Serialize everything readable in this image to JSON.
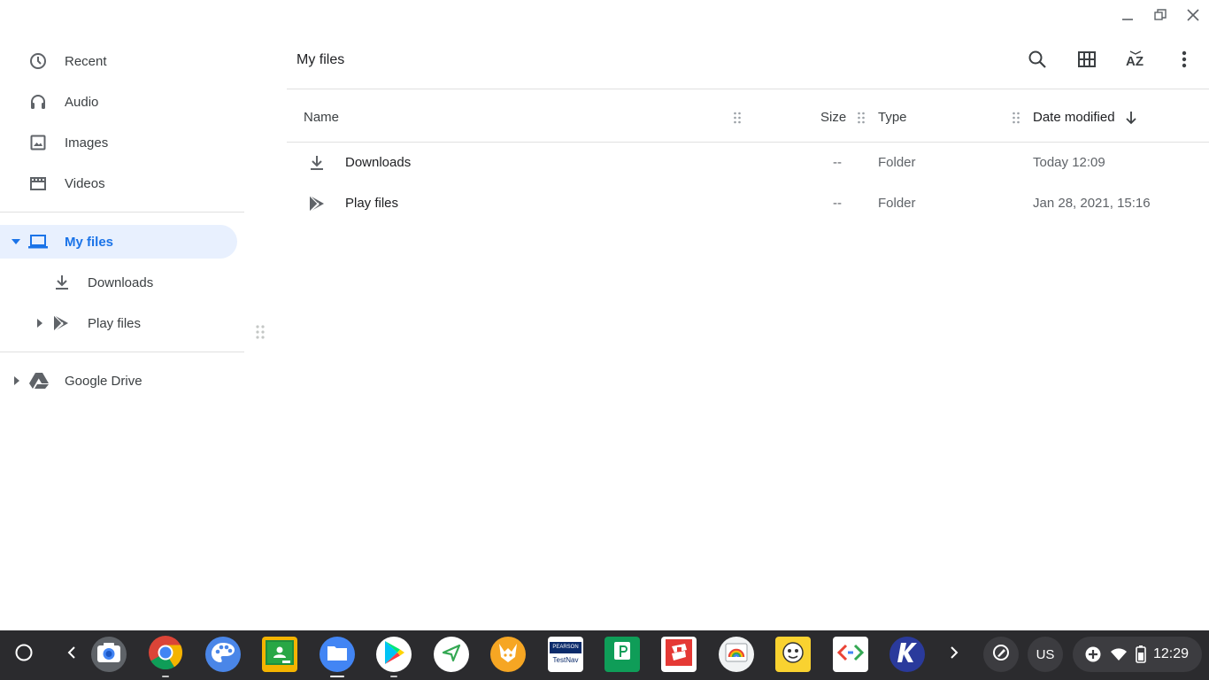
{
  "window": {
    "controls": [
      "minimize-icon",
      "restore-icon",
      "close-icon"
    ]
  },
  "sidebar": {
    "items": [
      {
        "label": "Recent",
        "icon": "clock-icon"
      },
      {
        "label": "Audio",
        "icon": "headphones-icon"
      },
      {
        "label": "Images",
        "icon": "image-icon"
      },
      {
        "label": "Videos",
        "icon": "video-icon"
      }
    ],
    "my_files": {
      "label": "My files",
      "icon": "laptop-icon",
      "expanded": true
    },
    "children": [
      {
        "label": "Downloads",
        "icon": "download-icon"
      },
      {
        "label": "Play files",
        "icon": "play-store-icon"
      }
    ],
    "drive": {
      "label": "Google Drive",
      "icon": "google-drive-icon"
    }
  },
  "main": {
    "title": "My files",
    "toolbar": [
      "search-icon",
      "grid-view-icon",
      "sort-az-icon",
      "more-vert-icon"
    ],
    "columns": {
      "name": "Name",
      "size": "Size",
      "type": "Type",
      "date": "Date modified"
    },
    "rows": [
      {
        "name": "Downloads",
        "size": "--",
        "type": "Folder",
        "date": "Today 12:09",
        "icon": "download-icon"
      },
      {
        "name": "Play files",
        "size": "--",
        "type": "Folder",
        "date": "Jan 28, 2021, 15:16",
        "icon": "play-store-icon"
      }
    ]
  },
  "shelf": {
    "apps": [
      "launcher-icon",
      "back-icon",
      "camera-icon",
      "chrome-icon",
      "canvas-icon",
      "classroom-icon",
      "files-icon",
      "play-store-icon",
      "send-icon",
      "fox-app-icon",
      "testnav-icon",
      "pear-deck-icon",
      "drawing-app-icon",
      "cursive-icon",
      "monkey-app-icon",
      "code-icon",
      "kahoot-icon",
      "more-apps-icon"
    ],
    "testnav_top": "PEARSON",
    "testnav_bottom": "TestNav",
    "ime": "US",
    "time": "12:29"
  },
  "colors": {
    "accent": "#1a73e8",
    "active_bg": "#e8f0fe",
    "shelf_bg": "#2b2b2e"
  }
}
